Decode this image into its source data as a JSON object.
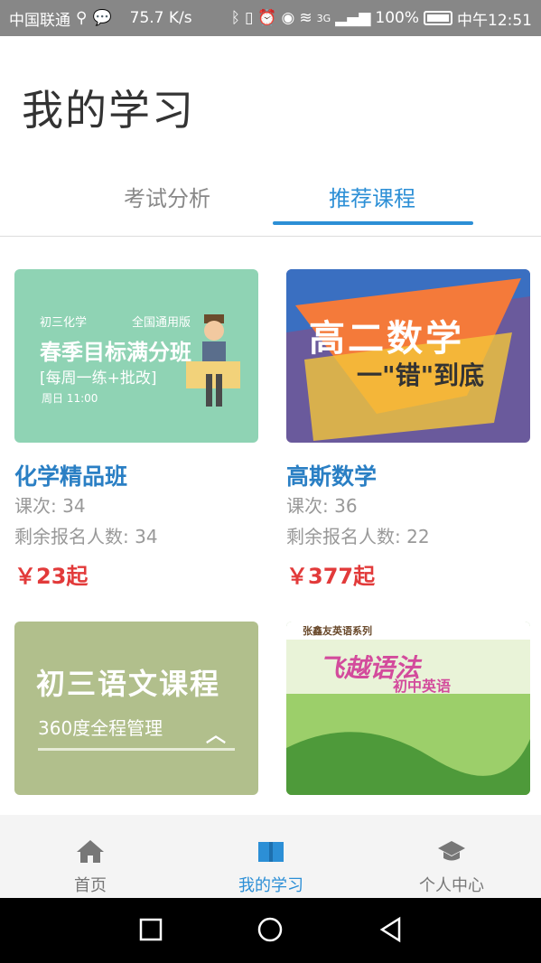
{
  "status_bar": {
    "carrier": "中国联通",
    "speed": "75.7 K/s",
    "network": "3G",
    "battery": "100%",
    "time": "中午12:51"
  },
  "header": {
    "title": "我的学习"
  },
  "tabs": [
    {
      "label": "考试分析",
      "active": false
    },
    {
      "label": "推荐课程",
      "active": true
    }
  ],
  "courses": [
    {
      "title": "化学精品班",
      "lessons": "课次: 34",
      "remaining": "剩余报名人数: 34",
      "price": "￥23起",
      "thumb": {
        "line1": "初三化学",
        "line1b": "全国通用版",
        "line2": "春季目标满分班",
        "line3": "[每周一练+批改]",
        "line4": "周日 11:00"
      }
    },
    {
      "title": "高斯数学",
      "lessons": "课次: 36",
      "remaining": "剩余报名人数: 22",
      "price": "￥377起",
      "thumb": {
        "line1": "高二数学",
        "line2": "一\"错\"到底"
      }
    },
    {
      "title": "",
      "thumb": {
        "line1": "初三语文课程",
        "line2": "360度全程管理"
      }
    },
    {
      "title": "",
      "thumb": {
        "line0": "张鑫友英语系列",
        "line1": "飞越语法",
        "line2": "初中英语"
      }
    }
  ],
  "bottom_nav": [
    {
      "label": "首页",
      "icon": "home-icon",
      "active": false
    },
    {
      "label": "我的学习",
      "icon": "book-icon",
      "active": true
    },
    {
      "label": "个人中心",
      "icon": "graduation-cap-icon",
      "active": false
    }
  ],
  "colors": {
    "accent": "#2c8fd6",
    "price": "#e23a3a",
    "title": "#2a7fc4"
  }
}
